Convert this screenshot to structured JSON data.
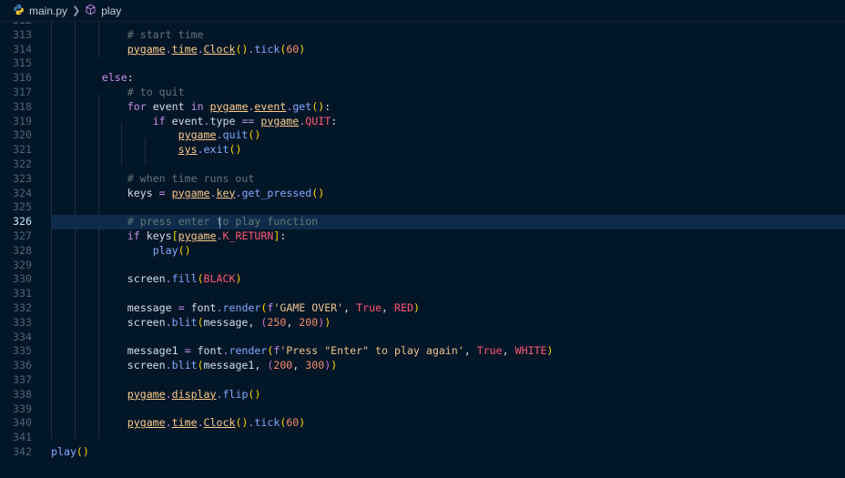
{
  "breadcrumb": {
    "file": "main.py",
    "symbol": "play",
    "python_icon": "python-icon",
    "symbol_icon": "method-cube-icon"
  },
  "editor": {
    "current_line": "326",
    "lines": [
      {
        "n": "312",
        "text": ""
      },
      {
        "n": "313",
        "text": "            # start time"
      },
      {
        "n": "314",
        "text": "            pygame.time.Clock().tick(60)"
      },
      {
        "n": "315",
        "text": ""
      },
      {
        "n": "316",
        "text": "        else:"
      },
      {
        "n": "317",
        "text": "            # to quit"
      },
      {
        "n": "318",
        "text": "            for event in pygame.event.get():"
      },
      {
        "n": "319",
        "text": "                if event.type == pygame.QUIT:"
      },
      {
        "n": "320",
        "text": "                    pygame.quit()"
      },
      {
        "n": "321",
        "text": "                    sys.exit()"
      },
      {
        "n": "322",
        "text": ""
      },
      {
        "n": "323",
        "text": "            # when time runs out"
      },
      {
        "n": "324",
        "text": "            keys = pygame.key.get_pressed()"
      },
      {
        "n": "325",
        "text": ""
      },
      {
        "n": "326",
        "text": "            # press enter to play function"
      },
      {
        "n": "327",
        "text": "            if keys[pygame.K_RETURN]:"
      },
      {
        "n": "328",
        "text": "                play()"
      },
      {
        "n": "329",
        "text": ""
      },
      {
        "n": "330",
        "text": "            screen.fill(BLACK)"
      },
      {
        "n": "331",
        "text": ""
      },
      {
        "n": "332",
        "text": "            message = font.render(f'GAME OVER', True, RED)"
      },
      {
        "n": "333",
        "text": "            screen.blit(message, (250, 200))"
      },
      {
        "n": "334",
        "text": ""
      },
      {
        "n": "335",
        "text": "            message1 = font.render(f'Press \"Enter\" to play again', True, WHITE)"
      },
      {
        "n": "336",
        "text": "            screen.blit(message1, (200, 300))"
      },
      {
        "n": "337",
        "text": ""
      },
      {
        "n": "338",
        "text": "            pygame.display.flip()"
      },
      {
        "n": "339",
        "text": ""
      },
      {
        "n": "340",
        "text": "            pygame.time.Clock().tick(60)"
      },
      {
        "n": "341",
        "text": ""
      },
      {
        "n": "342",
        "text": "play()"
      }
    ]
  },
  "colors": {
    "background": "#011627",
    "current_line": "#0f2b4a",
    "comment": "#637777",
    "keyword": "#c792ea",
    "module": "#ffcb8b"
  }
}
